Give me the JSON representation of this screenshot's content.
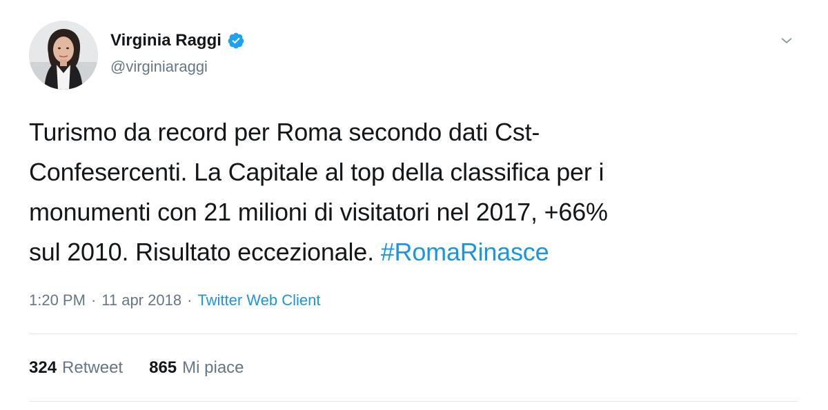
{
  "author": {
    "display_name": "Virginia Raggi",
    "handle": "@virginiaraggi",
    "verified": true
  },
  "tweet": {
    "text_lines": [
      "Turismo da record per Roma secondo dati Cst-",
      "Confesercenti. La Capitale al top della classifica per i",
      "monumenti con 21 milioni di visitatori nel 2017, +66%"
    ],
    "last_line_text": "sul 2010. Risultato eccezionale.",
    "hashtag": "#RomaRinasce"
  },
  "meta": {
    "time": "1:20 PM",
    "separator": "·",
    "date": "11 apr 2018",
    "source": "Twitter Web Client"
  },
  "stats": {
    "retweets_count": "324",
    "retweets_label": "Retweet",
    "likes_count": "865",
    "likes_label": "Mi piace"
  },
  "colors": {
    "link": "#1b95e0",
    "secondary_text": "#657786",
    "primary_text": "#14171a",
    "verified_badge": "#1da1f2"
  },
  "icons": {
    "verified": "verified-badge-icon",
    "caret": "chevron-down-icon"
  }
}
